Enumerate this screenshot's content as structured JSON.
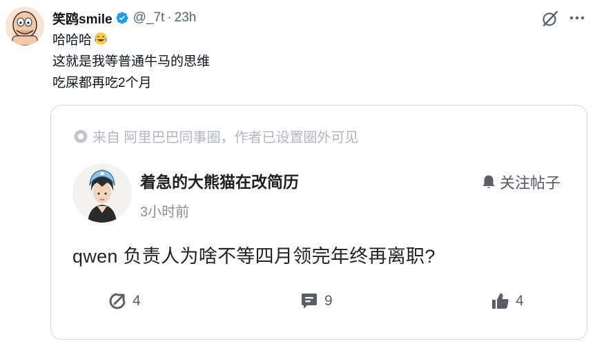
{
  "tweet": {
    "display_name": "笑鸥smile",
    "handle": "@_7t",
    "separator": "·",
    "time": "23h",
    "lines": [
      "哈哈哈",
      "这就是我等普通牛马的思维",
      "吃屎都再吃2个月"
    ],
    "emoji": "face-with-tears-of-joy"
  },
  "card": {
    "source": "来自 阿里巴巴同事圈，作者已设置圈外可见",
    "author": "着急的大熊猫在改简历",
    "posted": "3小时前",
    "follow_label": "关注帖子",
    "question": "qwen 负责人为啥不等四月领完年终再离职?",
    "actions": {
      "share_count": "4",
      "comment_count": "9",
      "like_count": "4"
    }
  },
  "colors": {
    "verified": "#1d9bf0",
    "muted_text": "#536471",
    "border": "#cfd9de"
  }
}
